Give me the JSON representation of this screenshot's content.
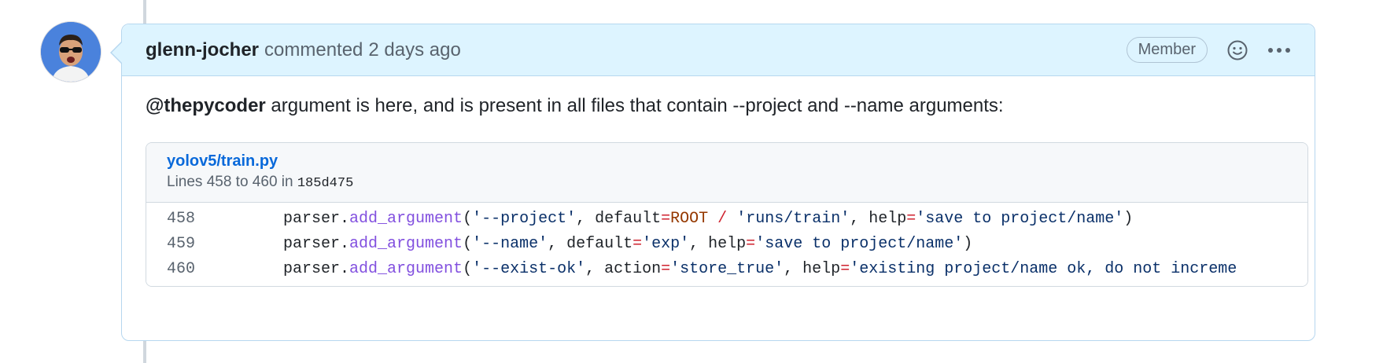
{
  "comment": {
    "author": "glenn-jocher",
    "action": "commented",
    "time_ago": "2 days ago",
    "role_badge": "Member",
    "icons": {
      "reaction": "smiley-icon",
      "menu": "kebab-horizontal-icon"
    },
    "body": {
      "mention": "@thepycoder",
      "text": " argument is here, and is present in all files that contain --project and --name arguments:"
    },
    "snippet": {
      "file": "yolov5/train.py",
      "lines_prefix": "Lines 458 to 460 in ",
      "commit": "185d475",
      "lines": [
        {
          "number": "458",
          "tokens": [
            {
              "t": "    parser.",
              "c": ""
            },
            {
              "t": "add_argument",
              "c": "fn"
            },
            {
              "t": "(",
              "c": ""
            },
            {
              "t": "'--project'",
              "c": "str"
            },
            {
              "t": ", default",
              "c": ""
            },
            {
              "t": "=",
              "c": "op"
            },
            {
              "t": "ROOT",
              "c": "const"
            },
            {
              "t": " / ",
              "c": "op"
            },
            {
              "t": "'runs/train'",
              "c": "str"
            },
            {
              "t": ", help",
              "c": ""
            },
            {
              "t": "=",
              "c": "op"
            },
            {
              "t": "'save to project/name'",
              "c": "str"
            },
            {
              "t": ")",
              "c": ""
            }
          ]
        },
        {
          "number": "459",
          "tokens": [
            {
              "t": "    parser.",
              "c": ""
            },
            {
              "t": "add_argument",
              "c": "fn"
            },
            {
              "t": "(",
              "c": ""
            },
            {
              "t": "'--name'",
              "c": "str"
            },
            {
              "t": ", default",
              "c": ""
            },
            {
              "t": "=",
              "c": "op"
            },
            {
              "t": "'exp'",
              "c": "str"
            },
            {
              "t": ", help",
              "c": ""
            },
            {
              "t": "=",
              "c": "op"
            },
            {
              "t": "'save to project/name'",
              "c": "str"
            },
            {
              "t": ")",
              "c": ""
            }
          ]
        },
        {
          "number": "460",
          "tokens": [
            {
              "t": "    parser.",
              "c": ""
            },
            {
              "t": "add_argument",
              "c": "fn"
            },
            {
              "t": "(",
              "c": ""
            },
            {
              "t": "'--exist-ok'",
              "c": "str"
            },
            {
              "t": ", action",
              "c": ""
            },
            {
              "t": "=",
              "c": "op"
            },
            {
              "t": "'store_true'",
              "c": "str"
            },
            {
              "t": ", help",
              "c": ""
            },
            {
              "t": "=",
              "c": "op"
            },
            {
              "t": "'existing project/name ok, do not increme",
              "c": "str"
            }
          ]
        }
      ]
    }
  },
  "colors": {
    "header_bg": "#ddf4ff",
    "border": "#b6d7ef",
    "link": "#0969da",
    "fn": "#8250df",
    "string": "#0a3069",
    "operator": "#cf222e",
    "constant": "#953800"
  }
}
